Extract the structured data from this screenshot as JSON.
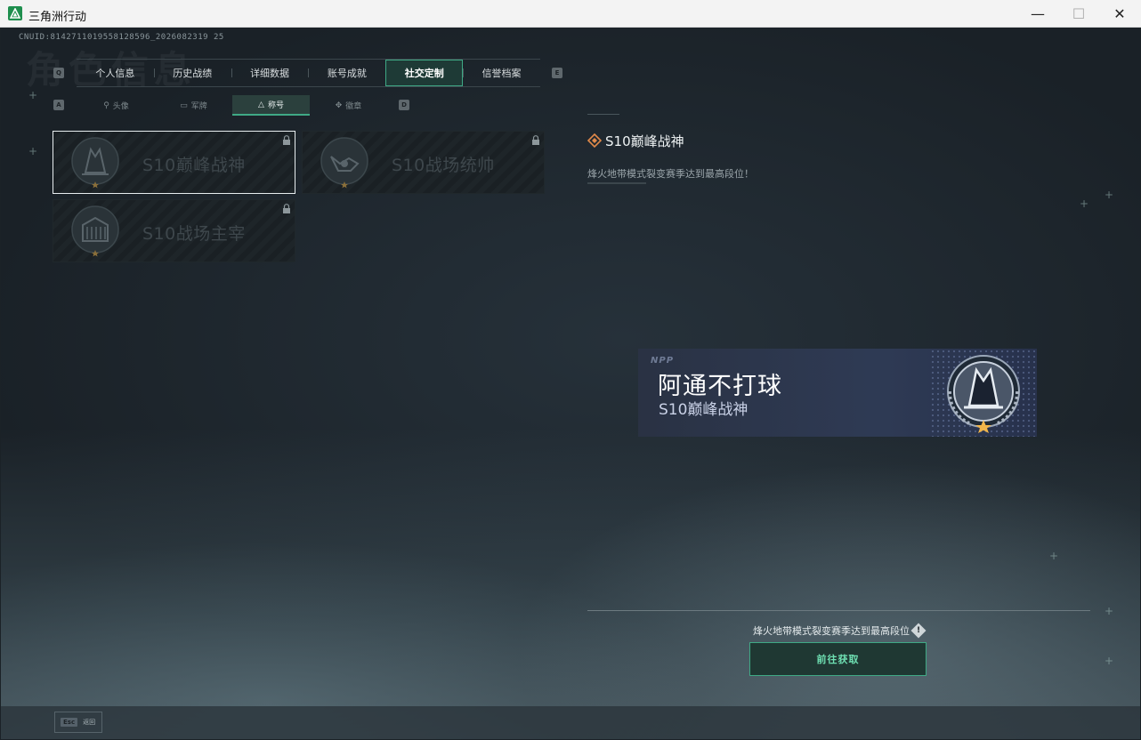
{
  "window": {
    "title": "三角洲行动",
    "minimize_glyph": "—",
    "maximize_glyph": "☐",
    "close_glyph": "✕"
  },
  "uid_text": "CNUID:8142711019558128596_2026082319 25",
  "page_watermark": "角色信息",
  "main_tabs": {
    "left_key": "Q",
    "right_key": "E",
    "items": [
      {
        "label": "个人信息"
      },
      {
        "label": "历史战绩"
      },
      {
        "label": "详细数据"
      },
      {
        "label": "账号成就"
      },
      {
        "label": "社交定制",
        "active": true
      },
      {
        "label": "信誉档案"
      }
    ]
  },
  "sub_tabs": {
    "left_key": "A",
    "right_key": "D",
    "items": [
      {
        "label": "头像",
        "icon": "person-icon"
      },
      {
        "label": "军牌",
        "icon": "dogtag-icon"
      },
      {
        "label": "称号",
        "icon": "triangle-icon",
        "active": true
      },
      {
        "label": "徽章",
        "icon": "badge-icon"
      }
    ]
  },
  "title_cards": [
    {
      "name": "S10巅峰战神",
      "locked": true,
      "selected": true,
      "emblem": "peak-warlord-emblem"
    },
    {
      "name": "S10战场统帅",
      "locked": true,
      "selected": false,
      "emblem": "battlefield-commander-emblem"
    },
    {
      "name": "S10战场主宰",
      "locked": true,
      "selected": false,
      "emblem": "battlefield-ruler-emblem"
    }
  ],
  "detail": {
    "title": "S10巅峰战神",
    "description": "烽火地带模式裂变赛季达到最高段位！"
  },
  "preview": {
    "brand": "NPP",
    "player_name": "阿通不打球",
    "title": "S10巅峰战神"
  },
  "unlock": {
    "requirement": "烽火地带模式裂变赛季达到最高段位",
    "info_glyph": "!",
    "button_label": "前往获取"
  },
  "footer": {
    "esc_key": "Esc",
    "esc_label": "返回"
  },
  "colors": {
    "accent": "#3fa985",
    "accent_text": "#6fe0b3",
    "background": "#1b2227",
    "preview_bg": "#2e3a58"
  }
}
